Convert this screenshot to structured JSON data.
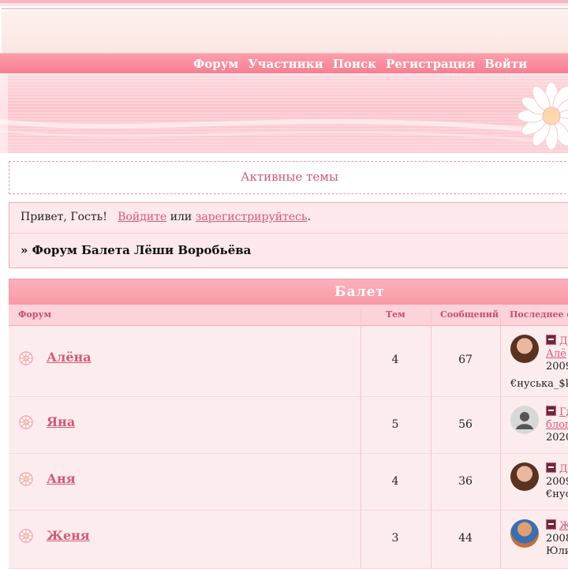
{
  "nav": {
    "items": [
      "Форум",
      "Участники",
      "Поиск",
      "Регистрация",
      "Войти"
    ]
  },
  "active_topics": "Активные темы",
  "welcome": {
    "greeting": "Привет, Гость!",
    "login": "Войдите",
    "or": "или",
    "register": "зарегистрируйтесь",
    "dot": ".",
    "breadcrumb": "» Форум Балета Лёши Воробьёва"
  },
  "category": {
    "title": "Балет"
  },
  "table_headers": {
    "forum": "Форум",
    "topics": "Тем",
    "posts": "Сообщений",
    "last": "Последнее с"
  },
  "forums": [
    {
      "name": "Алёна",
      "topics": "4",
      "posts": "67",
      "last_link1": "Де",
      "last_link2": "Алё",
      "last_date": "2009",
      "last_user": "€нуська_$k"
    },
    {
      "name": "Яна",
      "topics": "5",
      "posts": "56",
      "last_link1": "Гд",
      "last_link2": "блог",
      "last_date": "2020",
      "last_user": ""
    },
    {
      "name": "Аня",
      "topics": "4",
      "posts": "36",
      "last_link1": "Де",
      "last_link2": "",
      "last_date": "2009",
      "last_user": "€нус"
    },
    {
      "name": "Женя",
      "topics": "3",
      "posts": "44",
      "last_link1": "Ж",
      "last_link2": "",
      "last_date": "2008",
      "last_user": "Юли"
    }
  ],
  "colors": {
    "accent": "#d05a78",
    "navbar": "#f77f91",
    "row_bg": "#fdecee"
  }
}
